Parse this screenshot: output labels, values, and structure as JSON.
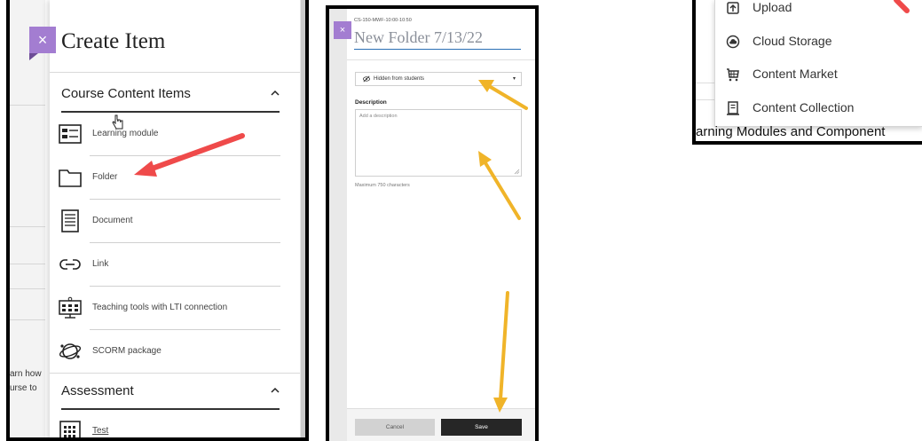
{
  "panel_create": {
    "title": "Create Item",
    "close_label": "×",
    "background_text": [
      "arn how",
      "urse to"
    ],
    "sections": [
      {
        "title": "Course Content Items",
        "items": [
          {
            "label": "Learning module",
            "icon": "learning-module-icon"
          },
          {
            "label": "Folder",
            "icon": "folder-icon"
          },
          {
            "label": "Document",
            "icon": "document-icon"
          },
          {
            "label": "Link",
            "icon": "link-icon"
          },
          {
            "label": "Teaching tools with LTI connection",
            "icon": "lti-tools-icon"
          },
          {
            "label": "SCORM package",
            "icon": "scorm-package-icon"
          }
        ]
      },
      {
        "title": "Assessment",
        "items": [
          {
            "label": "Test",
            "icon": "test-icon"
          }
        ]
      }
    ]
  },
  "panel_folder": {
    "close_label": "×",
    "breadcrumb": "CS-150-MWF-10:00-10:50",
    "folder_name": "New Folder 7/13/22",
    "visibility": "Hidden from students",
    "description_label": "Description",
    "description_placeholder": "Add a description",
    "max_chars": "Maximum 750 characters",
    "cancel_label": "Cancel",
    "save_label": "Save"
  },
  "panel_menu": {
    "items": [
      {
        "label": "Upload",
        "icon": "upload-icon"
      },
      {
        "label": "Cloud Storage",
        "icon": "cloud-storage-icon"
      },
      {
        "label": "Content Market",
        "icon": "content-market-icon"
      },
      {
        "label": "Content Collection",
        "icon": "content-collection-icon"
      }
    ],
    "background_heading": "arning Modules and Component"
  },
  "colors": {
    "accent_purple": "#a37dd1",
    "arrow_red": "#ef4a4a",
    "arrow_orange": "#f0b429",
    "save_button": "#262626",
    "input_underline": "#2a6fb5"
  }
}
